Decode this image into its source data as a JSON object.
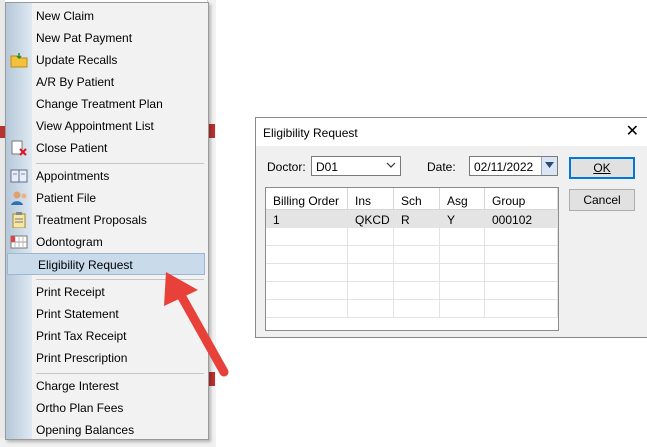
{
  "menu": {
    "groups": [
      [
        {
          "label": "New Claim",
          "icon": ""
        },
        {
          "label": "New Pat Payment",
          "icon": ""
        },
        {
          "label": "Update Recalls",
          "icon": "folder-icon"
        },
        {
          "label": "A/R By Patient",
          "icon": ""
        },
        {
          "label": "Change Treatment Plan",
          "icon": ""
        },
        {
          "label": "View Appointment List",
          "icon": ""
        },
        {
          "label": "Close Patient",
          "icon": "close-patient-icon"
        }
      ],
      [
        {
          "label": "Appointments",
          "icon": "appointment-book-icon"
        },
        {
          "label": "Patient File",
          "icon": "patient-file-icon"
        },
        {
          "label": "Treatment Proposals",
          "icon": "clipboard-icon"
        },
        {
          "label": "Odontogram",
          "icon": "odontogram-icon"
        },
        {
          "label": "Eligibility Request",
          "icon": "",
          "selected": true
        }
      ],
      [
        {
          "label": "Print Receipt",
          "icon": ""
        },
        {
          "label": "Print Statement",
          "icon": ""
        },
        {
          "label": "Print Tax Receipt",
          "icon": ""
        },
        {
          "label": "Print Prescription",
          "icon": ""
        }
      ],
      [
        {
          "label": "Charge Interest",
          "icon": ""
        },
        {
          "label": "Ortho Plan Fees",
          "icon": ""
        },
        {
          "label": "Opening Balances",
          "icon": ""
        }
      ]
    ]
  },
  "dialog": {
    "title": "Eligibility Request",
    "doctor_label": "Doctor:",
    "doctor_value": "D01",
    "date_label": "Date:",
    "date_value": "02/11/2022",
    "ok_label": "OK",
    "cancel_label": "Cancel",
    "table": {
      "columns": [
        "Billing Order",
        "Ins",
        "Sch",
        "Asg",
        "Group"
      ],
      "rows": [
        [
          "1",
          "QKCD",
          "R",
          "Y",
          "000102"
        ]
      ]
    }
  },
  "colors": {
    "arrow": "#e8413a",
    "menu_gutter": "#c4d3e2",
    "selection": "#c9daea",
    "focus_border": "#0078d7"
  }
}
